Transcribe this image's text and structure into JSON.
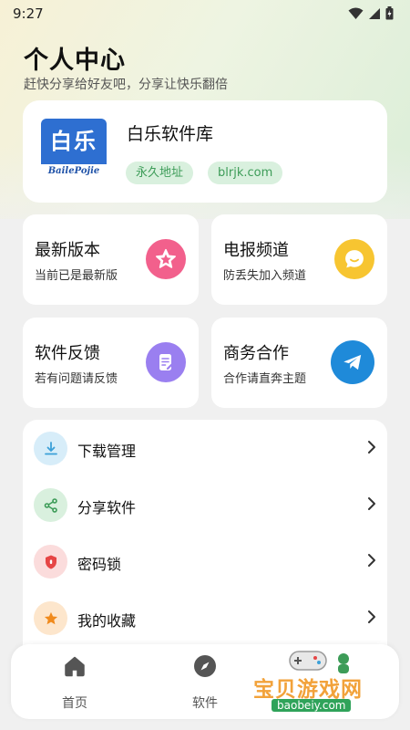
{
  "status_bar": {
    "time": "9:27"
  },
  "header": {
    "title": "个人中心",
    "subtitle": "赶快分享给好友吧，分享让快乐翻倍"
  },
  "app_card": {
    "logo_text": "白乐",
    "logo_subtext": "BailePojie",
    "name": "白乐软件库",
    "tags": [
      "永久地址",
      "blrjk.com"
    ]
  },
  "features": [
    {
      "title": "最新版本",
      "desc": "当前已是最新版",
      "icon": "star-icon",
      "color": "#f2608c"
    },
    {
      "title": "电报频道",
      "desc": "防丢失加入频道",
      "icon": "chat-bubble-icon",
      "color": "#f7c531"
    },
    {
      "title": "软件反馈",
      "desc": "若有问题请反馈",
      "icon": "edit-note-icon",
      "color": "#9a7ff0"
    },
    {
      "title": "商务合作",
      "desc": "合作请直奔主题",
      "icon": "telegram-icon",
      "color": "#1f8ad9"
    }
  ],
  "menu": [
    {
      "label": "下载管理",
      "icon": "download-icon",
      "color": "#3ba0d8",
      "bg": "#d7edf9"
    },
    {
      "label": "分享软件",
      "icon": "share-icon",
      "color": "#3d9c58",
      "bg": "#d9f0de"
    },
    {
      "label": "密码锁",
      "icon": "shield-icon",
      "color": "#e64545",
      "bg": "#fbdcdc"
    },
    {
      "label": "我的收藏",
      "icon": "star-icon",
      "color": "#f08a1c",
      "bg": "#fde6cc"
    }
  ],
  "bottom_nav": [
    {
      "label": "首页",
      "icon": "home-icon"
    },
    {
      "label": "软件",
      "icon": "compass-icon"
    }
  ],
  "watermark": {
    "text": "宝贝游戏网",
    "url": "baobeiy.com"
  }
}
